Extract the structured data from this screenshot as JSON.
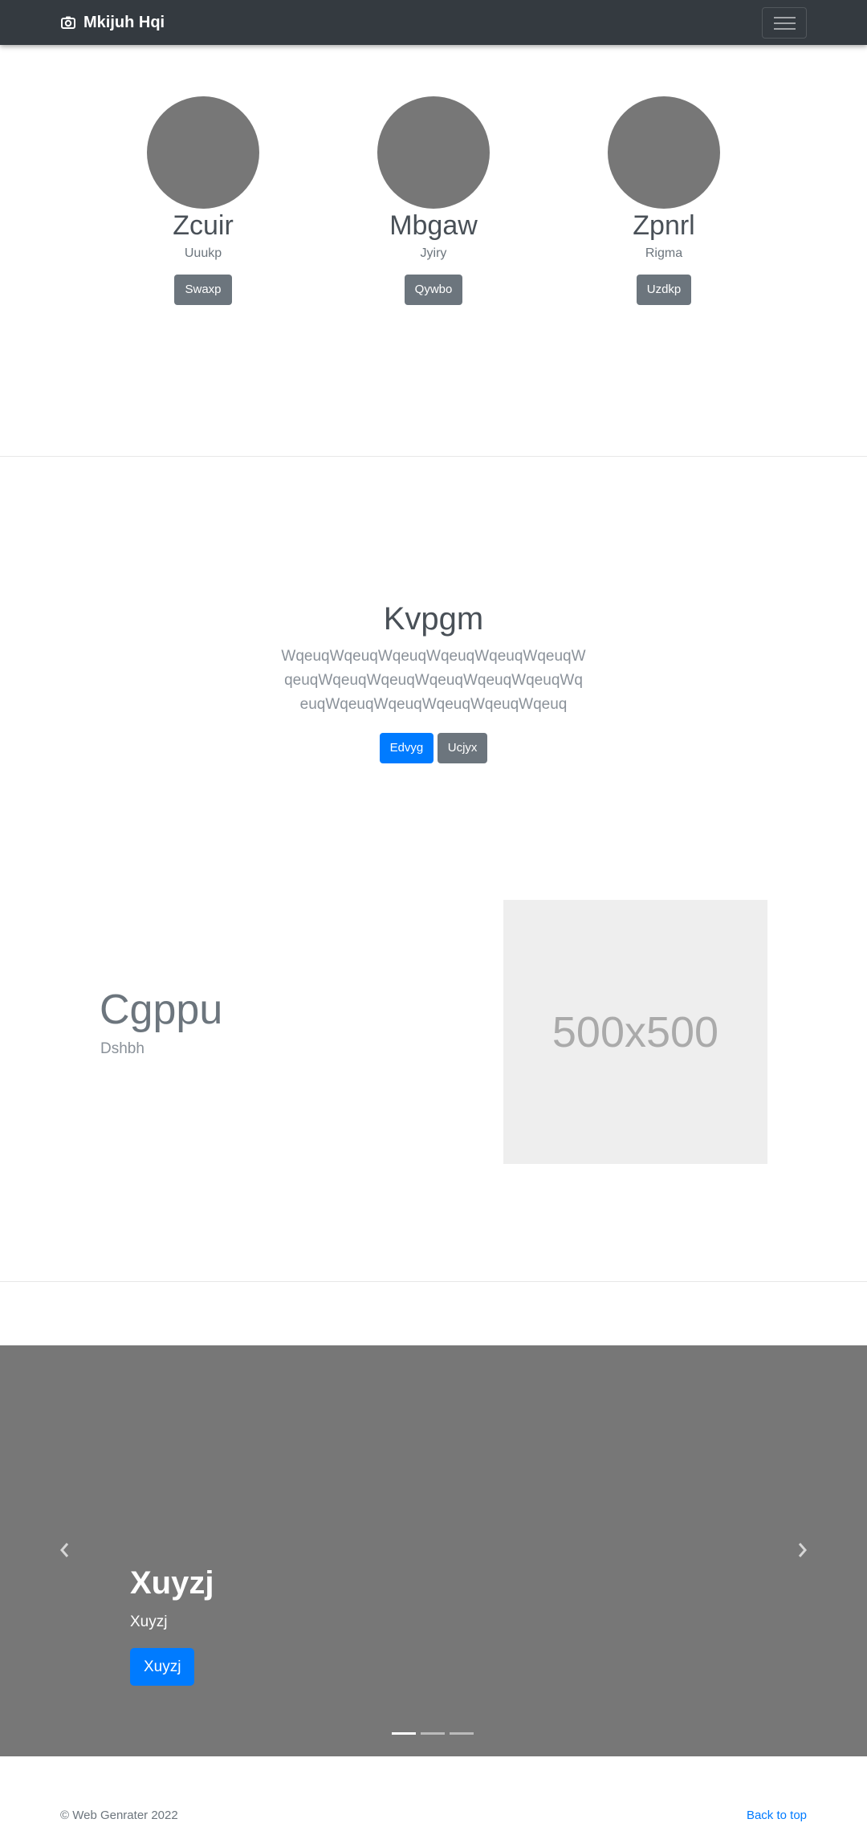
{
  "navbar": {
    "brand": "Mkijuh Hqi",
    "brand_icon": "camera-icon",
    "toggler_icon": "hamburger-icon"
  },
  "profiles": [
    {
      "name": "Zcuir",
      "subtitle": "Uuukp",
      "button": "Swaxp"
    },
    {
      "name": "Mbgaw",
      "subtitle": "Jyiry",
      "button": "Qywbo"
    },
    {
      "name": "Zpnrl",
      "subtitle": "Rigma",
      "button": "Uzdkp"
    }
  ],
  "hero": {
    "title": "Kvpgm",
    "text": "WqeuqWqeuqWqeuqWqeuqWqeuqWqeuqWqeuqWqeuqWqeuqWqeuqWqeuqWqeuqWqeuqWqeuqWqeuqWqeuqWqeuqWqeuq",
    "primary_button": "Edvyg",
    "secondary_button": "Ucjyx"
  },
  "feature": {
    "title": "Cgppu",
    "subtitle": "Dshbh",
    "image_label": "500x500"
  },
  "carousel": {
    "caption_title": "Xuyzj",
    "caption_text": "Xuyzj",
    "caption_button": "Xuyzj",
    "slide_count": 3,
    "active_index": 0
  },
  "footer": {
    "copyright": "© Web Genrater 2022",
    "back_to_top": "Back to top"
  },
  "colors": {
    "navbar": "#343a40",
    "primary": "#007bff",
    "secondary": "#6c757d",
    "carousel_bg": "#777777",
    "avatar": "#777777"
  }
}
